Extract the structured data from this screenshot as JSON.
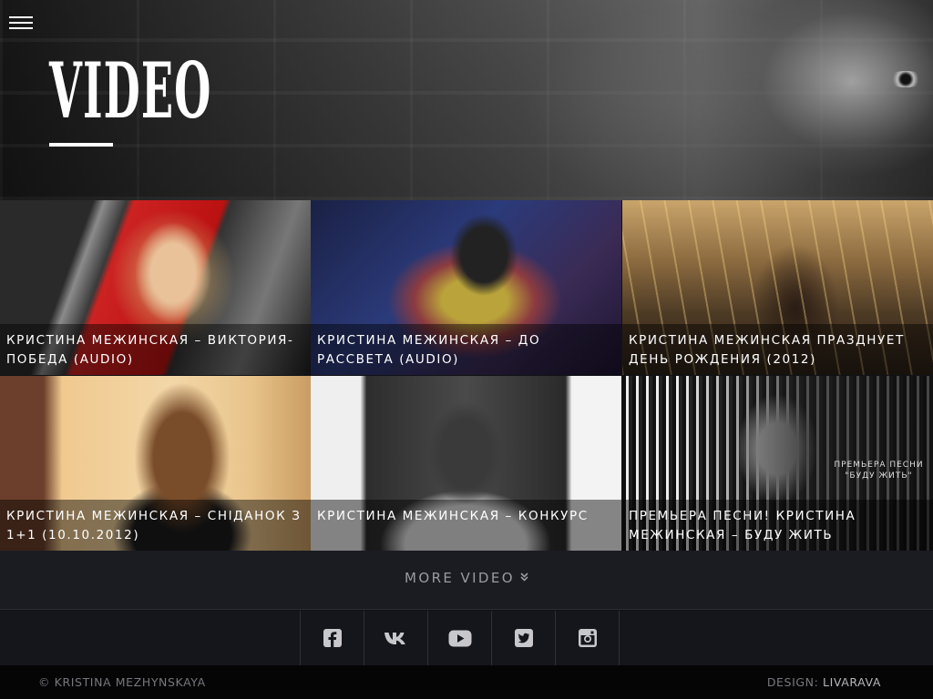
{
  "header": {
    "menu_icon": "hamburger-menu-icon",
    "title": "VIDEO"
  },
  "videos": [
    {
      "title": "КРИСТИНА МЕЖИНСКАЯ – ВИКТОРИЯ-ПОБЕДА (AUDIO)"
    },
    {
      "title": "КРИСТИНА МЕЖИНСКАЯ – ДО РАССВЕТА (AUDIO)"
    },
    {
      "title": "КРИСТИНА МЕЖИНСКАЯ ПРАЗДНУЕТ ДЕНЬ РОЖДЕНИЯ (2012)"
    },
    {
      "title": "КРИСТИНА МЕЖИНСКАЯ – СНІДАНОК З 1+1 (10.10.2012)"
    },
    {
      "title": "КРИСТИНА МЕЖИНСКАЯ – КОНКУРС"
    },
    {
      "title": "ПРЕМЬЕРА ПЕСНИ! КРИСТИНА МЕЖИНСКАЯ – БУДУ ЖИТЬ",
      "thumb_text": "ПРЕМЬЕРА ПЕСНИ \"БУДУ ЖИТЬ\""
    }
  ],
  "more": {
    "label": "MORE VIDEO",
    "icon": "double-chevron-down-icon"
  },
  "social": [
    {
      "icon": "facebook-icon"
    },
    {
      "icon": "vk-icon"
    },
    {
      "icon": "youtube-icon"
    },
    {
      "icon": "twitter-icon"
    },
    {
      "icon": "instagram-icon"
    }
  ],
  "footer": {
    "copyright": "© KRISTINA MEZHYNSKAYA",
    "design_label": "DESIGN:",
    "design_name": "LIVARAVA"
  },
  "colors": {
    "background": "#111216",
    "more_bar": "#1b1c22",
    "social_bar": "#15161b",
    "footer": "#050506",
    "text_muted": "#77777d",
    "icon": "#c8c8cc"
  }
}
